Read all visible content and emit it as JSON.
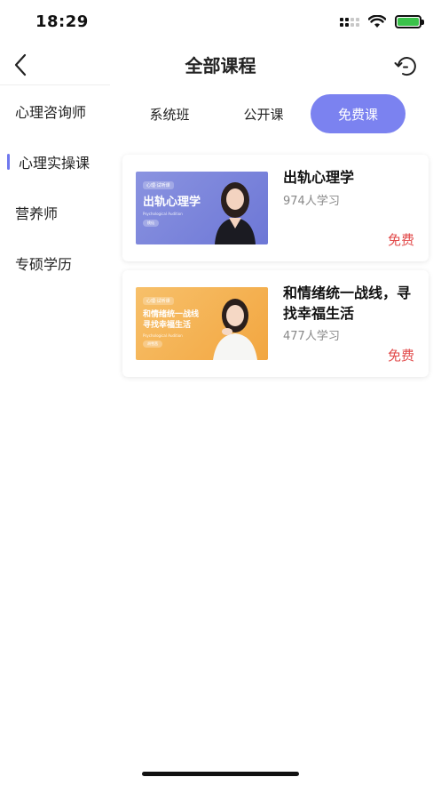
{
  "status_bar": {
    "time": "18:29"
  },
  "nav": {
    "title": "全部课程"
  },
  "sidebar": {
    "items": [
      {
        "label": "心理咨询师"
      },
      {
        "label": "心理实操课"
      },
      {
        "label": "营养师"
      },
      {
        "label": "专硕学历"
      }
    ],
    "active_index": 1
  },
  "tabs": [
    {
      "label": "系统班"
    },
    {
      "label": "公开课"
    },
    {
      "label": "免费课"
    }
  ],
  "active_tab_index": 2,
  "courses": [
    {
      "title": "出轨心理学",
      "learners": "974人学习",
      "price": "免费",
      "thumb_tag": "心理·试听课",
      "thumb_title": "出轨心理学",
      "thumb_subtitle": "Psychological Audition",
      "thumb_teacher": "桃仙"
    },
    {
      "title": "和情绪统一战线，寻找幸福生活",
      "learners": "477人学习",
      "price": "免费",
      "thumb_tag": "心理·试听课",
      "thumb_title": "和情绪统一战线",
      "thumb_title2": "寻找幸福生活",
      "thumb_subtitle": "Psychological Audition",
      "thumb_teacher": "胡雪茜"
    }
  ],
  "colors": {
    "accent": "#7b82f0",
    "indicator": "#6f78ee",
    "price": "#e24a4a",
    "battery": "#3ac24a"
  }
}
